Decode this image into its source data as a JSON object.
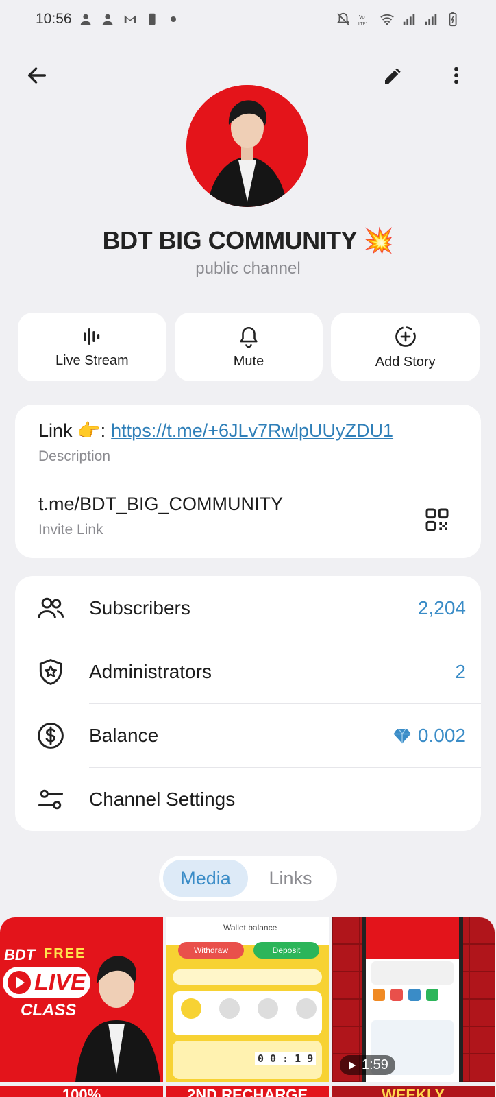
{
  "status_bar": {
    "time": "10:56"
  },
  "header": {
    "back_icon": "arrow-left-icon",
    "edit_icon": "pencil-icon",
    "menu_icon": "more-vert-icon"
  },
  "channel": {
    "title": "BDT BIG COMMUNITY 💥",
    "subtitle": "public channel"
  },
  "actions": [
    {
      "label": "Live Stream",
      "icon": "live-stream-icon"
    },
    {
      "label": "Mute",
      "icon": "bell-icon"
    },
    {
      "label": "Add Story",
      "icon": "add-story-icon"
    }
  ],
  "info": {
    "description_prefix": "Link 👉:",
    "description_link": "https://t.me/+6JLv7RwlpUUyZDU1",
    "description_label": "Description",
    "invite_link": "t.me/BDT_BIG_COMMUNITY",
    "invite_label": "Invite Link"
  },
  "stats": {
    "subscribers_label": "Subscribers",
    "subscribers_value": "2,204",
    "admins_label": "Administrators",
    "admins_value": "2",
    "balance_label": "Balance",
    "balance_value": "0.002",
    "settings_label": "Channel Settings"
  },
  "tabs": [
    {
      "label": "Media",
      "active": true
    },
    {
      "label": "Links",
      "active": false
    }
  ],
  "media": {
    "thumb1_top": "BDT",
    "thumb1_free": "FREE",
    "thumb1_live": "LIVE",
    "thumb1_class": "CLASS",
    "thumb2_wallet": "Wallet balance",
    "thumb2_withdraw": "Withdraw",
    "thumb2_deposit": "Deposit",
    "thumb2_timer": "0 0 : 1 9",
    "thumb3_duration": "1:59",
    "row2_a": "100%",
    "row2_b": "2ND RECHARGE",
    "row2_c": "WEEKLY"
  },
  "colors": {
    "accent": "#3a8cc7",
    "avatar_bg": "#e4141a",
    "background": "#f0f0f3"
  }
}
